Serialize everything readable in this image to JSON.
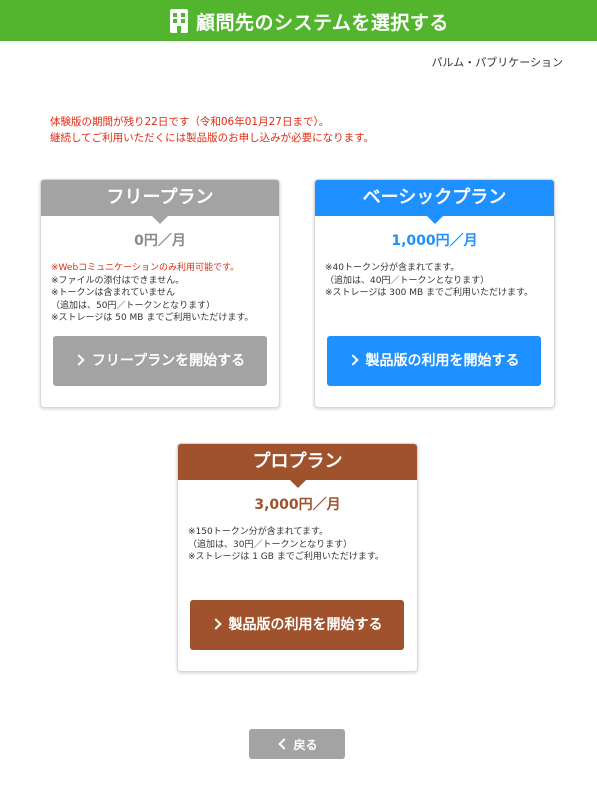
{
  "header": {
    "title": "顧問先のシステムを選択する",
    "icon": "building-icon",
    "bg_color": "#53b52e"
  },
  "organization": "パルム・パブリケーション",
  "notice": {
    "line1": "体験版の期間が残り22日です（令和06年01月27日まで）。",
    "line2": "継続してご利用いただくには製品版のお申し込みが必要になります。",
    "color": "#e02b12"
  },
  "plans": {
    "free": {
      "name": "フリープラン",
      "price": "0円／月",
      "color": "#a3a3a3",
      "notes": [
        "※Webコミュニケーションのみ利用可能です。",
        "※ファイルの添付はできません。",
        "※トークンは含まれていません",
        "（追加は、50円／トークンとなります）",
        "※ストレージは 50 MB までご利用いただけます。"
      ],
      "button": "フリープランを開始する"
    },
    "basic": {
      "name": "ベーシックプラン",
      "price": "1,000円／月",
      "color": "#1e90ff",
      "notes": [
        "※40トークン分が含まれてます。",
        "（追加は、40円／トークンとなります）",
        "※ストレージは 300 MB までご利用いただけます。"
      ],
      "button": "製品版の利用を開始する"
    },
    "pro": {
      "name": "プロプラン",
      "price": "3,000円／月",
      "color": "#a0522d",
      "notes": [
        "※150トークン分が含まれてます。",
        "（追加は、30円／トークンとなります）",
        "※ストレージは 1 GB までご利用いただけます。"
      ],
      "button": "製品版の利用を開始する"
    }
  },
  "back_button": "戻る"
}
